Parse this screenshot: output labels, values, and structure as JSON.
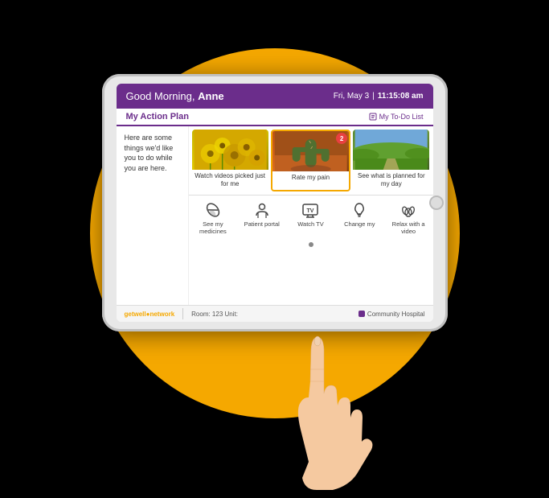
{
  "app": {
    "background_color": "#F5A800"
  },
  "header": {
    "greeting_prefix": "Good Morning, ",
    "patient_name": "Anne",
    "date_label": "Fri, May 3",
    "separator": "|",
    "time": "11:15:08 am"
  },
  "action_plan": {
    "title": "My Action Plan",
    "todo_button": "My To-Do List"
  },
  "left_panel": {
    "text": "Here are some things we'd like you to do while you are here."
  },
  "video_cards": [
    {
      "id": "card-watch-videos",
      "label": "Watch videos picked just for me",
      "thumb_class": "thumb-yellow",
      "badge": null
    },
    {
      "id": "card-rate",
      "label": "Rate my pain",
      "thumb_class": "thumb-orange",
      "badge": "2"
    },
    {
      "id": "card-see-day",
      "label": "See what is planned for my day",
      "thumb_class": "thumb-green",
      "badge": null
    }
  ],
  "bottom_icons": [
    {
      "id": "icon-medicines",
      "icon": "pill",
      "label": "See my medicines"
    },
    {
      "id": "icon-portal",
      "icon": "person",
      "label": "Patient portal"
    },
    {
      "id": "icon-tv",
      "icon": "tv",
      "label": "Watch TV"
    },
    {
      "id": "icon-change",
      "icon": "lightbulb",
      "label": "Change my"
    },
    {
      "id": "icon-relax",
      "icon": "relax",
      "label": "Relax with a video"
    }
  ],
  "footer": {
    "brand_text": "getwell",
    "brand_highlight": "network",
    "room": "Room: 123  Unit:",
    "hospital": "Community Hospital"
  }
}
